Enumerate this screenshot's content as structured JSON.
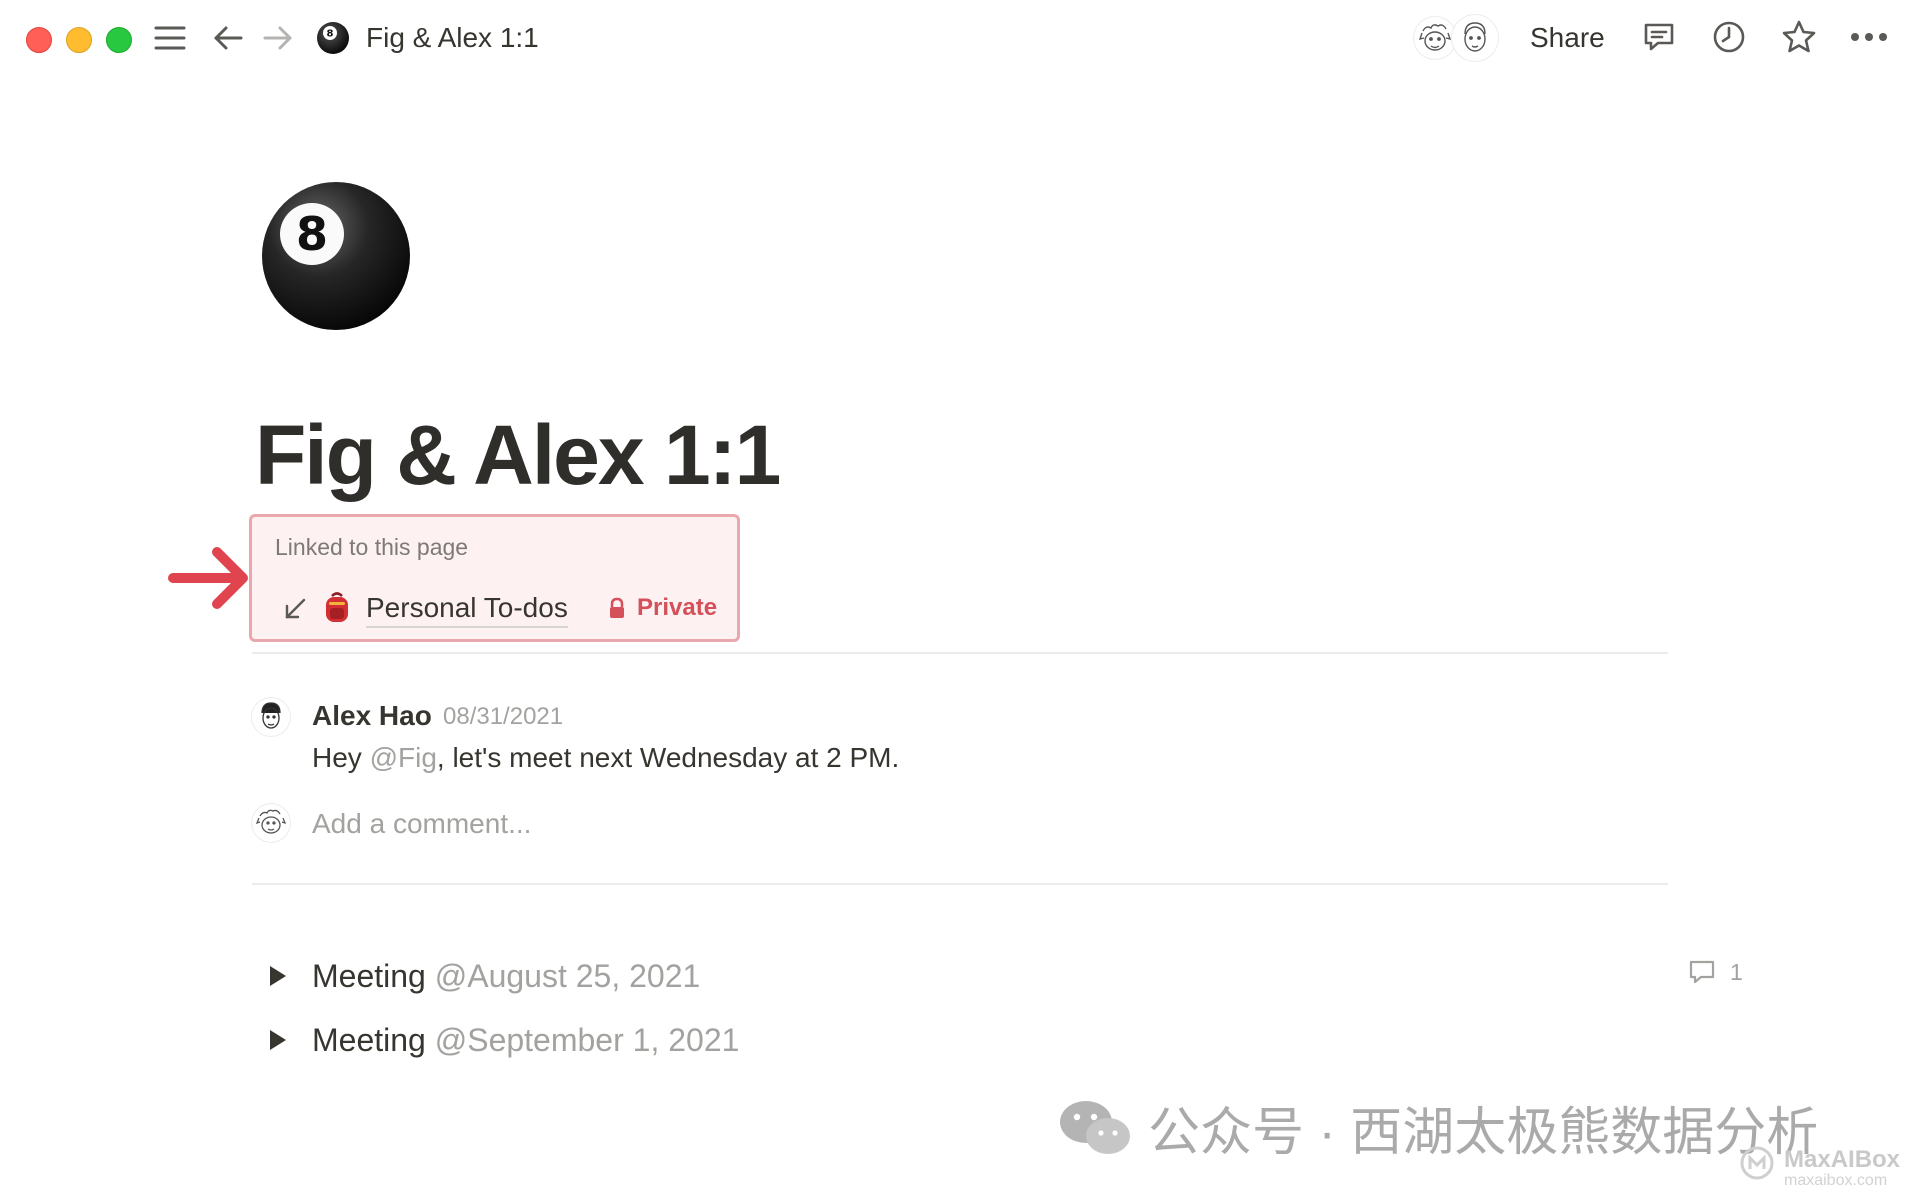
{
  "window": {
    "breadcrumb_title": "Fig & Alex 1:1",
    "share_label": "Share"
  },
  "page": {
    "title": "Fig & Alex 1:1",
    "icon": "8-ball-icon"
  },
  "backlinks": {
    "label": "Linked to this page",
    "item_title": "Personal To-dos",
    "item_icon": "backpack-icon",
    "private_label": "Private"
  },
  "comment": {
    "author": "Alex Hao",
    "date": "08/31/2021",
    "text_before": "Hey ",
    "mention": "@Fig",
    "text_after": ", let's meet next Wednesday at 2 PM.",
    "add_placeholder": "Add a comment..."
  },
  "toggles": [
    {
      "label": "Meeting",
      "date": "@August 25, 2021",
      "comment_count": "1"
    },
    {
      "label": "Meeting",
      "date": "@September 1, 2021"
    }
  ],
  "watermark": {
    "text": "公众号 · 西湖太极熊数据分析",
    "logo_text": "MaxAIBox",
    "logo_sub": "maxaibox.com"
  },
  "colors": {
    "backlink_border": "#e9a8ad",
    "private_red": "#d4515a",
    "arrow_red": "#e0454f"
  }
}
